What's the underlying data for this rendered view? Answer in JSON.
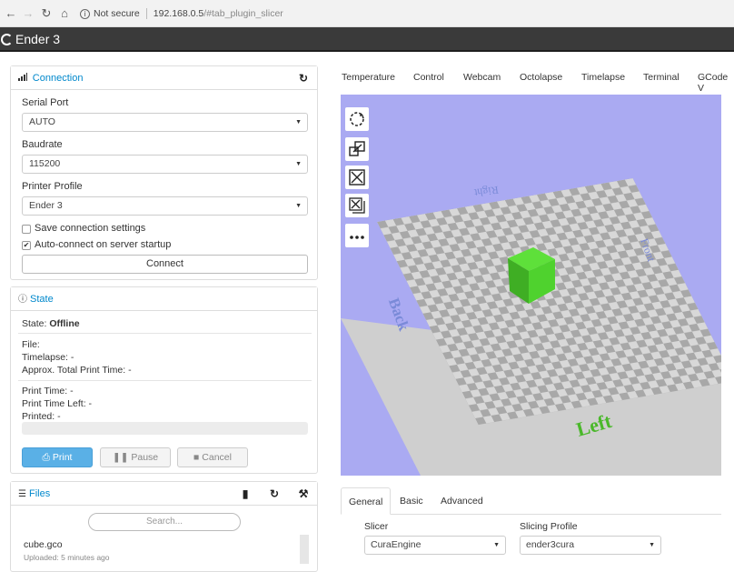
{
  "browser": {
    "not_secure": "Not secure",
    "host": "192.168.0.5",
    "path": "/#tab_plugin_slicer"
  },
  "app": {
    "title": "Ender 3"
  },
  "connection": {
    "title": "Connection",
    "serial_port_label": "Serial Port",
    "serial_port_value": "AUTO",
    "baudrate_label": "Baudrate",
    "baudrate_value": "115200",
    "profile_label": "Printer Profile",
    "profile_value": "Ender 3",
    "save_settings_label": "Save connection settings",
    "save_settings_checked": false,
    "autoconnect_label": "Auto-connect on server startup",
    "autoconnect_checked": true,
    "connect_button": "Connect"
  },
  "state": {
    "title": "State",
    "state_label": "State:",
    "state_value": "Offline",
    "file_label": "File:",
    "timelapse_label": "Timelapse:",
    "timelapse_value": "-",
    "approx_label": "Approx. Total Print Time:",
    "approx_value": "-",
    "print_time_label": "Print Time:",
    "print_time_value": "-",
    "time_left_label": "Print Time Left:",
    "time_left_value": "-",
    "printed_label": "Printed:",
    "printed_value": "-",
    "progress": 0,
    "print_button": "Print",
    "pause_button": "Pause",
    "cancel_button": "Cancel"
  },
  "files": {
    "title": "Files",
    "search_placeholder": "Search...",
    "items": [
      {
        "name": "cube.gco",
        "meta": "Uploaded: 5 minutes ago"
      }
    ]
  },
  "tabs": [
    "Temperature",
    "Control",
    "Webcam",
    "Octolapse",
    "Timelapse",
    "Terminal",
    "GCode V"
  ],
  "viewport": {
    "labels": {
      "back": "Back",
      "left": "Left",
      "right": "Right",
      "front": "Front"
    },
    "colors": {
      "background": "#aaaaf2",
      "cube": "#4fd22e",
      "bed_light": "#d8d8d8",
      "bed_dark": "#a8a8a8"
    }
  },
  "slicer_tabs": {
    "general": "General",
    "basic": "Basic",
    "advanced": "Advanced"
  },
  "slicer": {
    "slicer_label": "Slicer",
    "slicer_value": "CuraEngine",
    "profile_label": "Slicing Profile",
    "profile_value": "ender3cura"
  }
}
